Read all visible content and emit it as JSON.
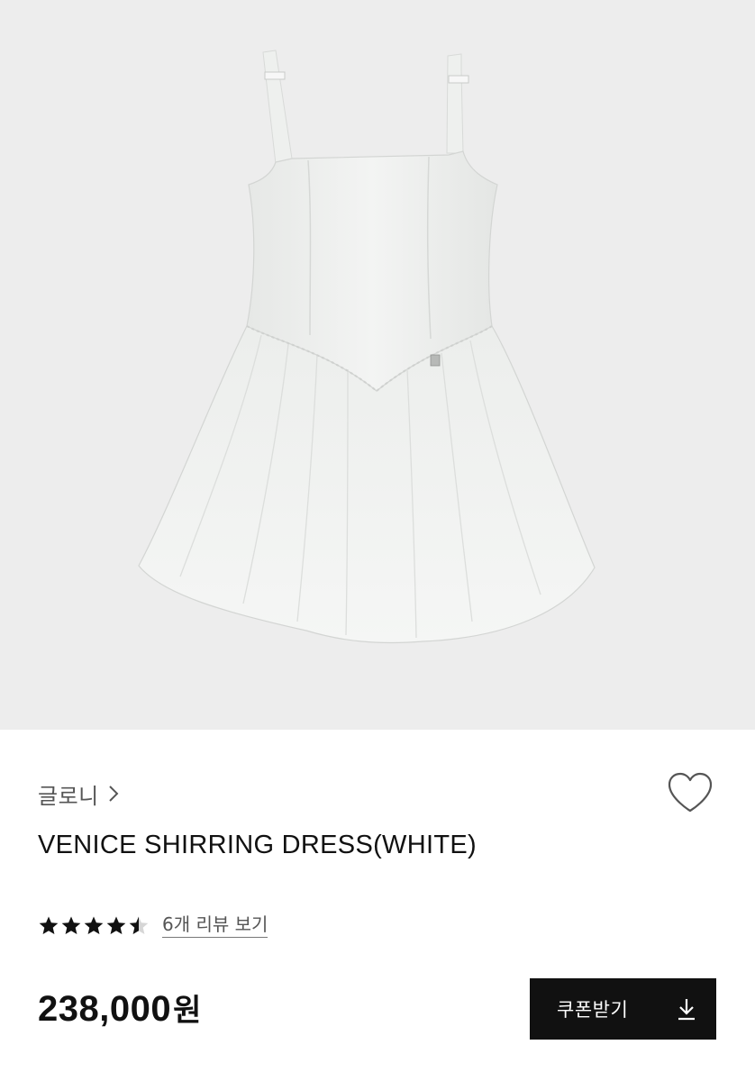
{
  "product": {
    "brand": "글로니",
    "title": "VENICE SHIRRING DRESS(WHITE)",
    "rating": 4.5,
    "rating_max": 5,
    "review_link": "6개 리뷰 보기",
    "price": "238,000",
    "price_unit": "원"
  },
  "coupon": {
    "label": "쿠폰받기"
  },
  "icons": {
    "brand_chevron": "chevron-right-icon",
    "wishlist": "heart-outline-icon",
    "coupon": "download-icon",
    "rating": "star-icon"
  },
  "colors": {
    "image_background": "#ededed",
    "coupon_button": "#111111",
    "secondary_text": "#555555"
  }
}
